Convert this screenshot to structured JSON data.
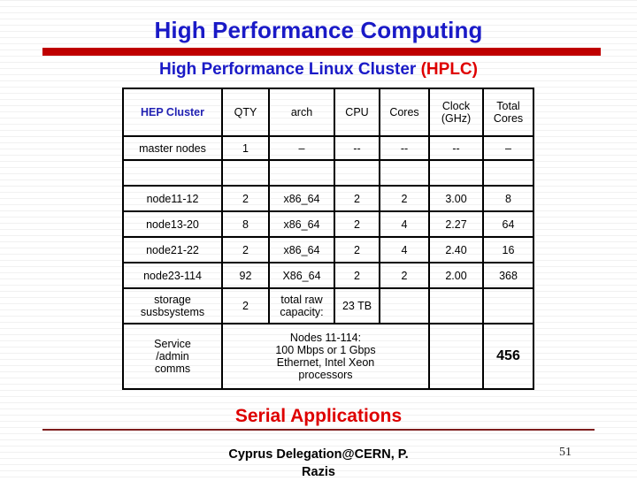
{
  "slide": {
    "title": "High Performance Computing",
    "subtitle_main": "High Performance Linux Cluster ",
    "subtitle_accent": "(HPLC)",
    "section_heading": "Serial Applications",
    "footer_line1": "Cyprus Delegation@CERN, P.",
    "footer_line2": "Razis",
    "page_number": "51",
    "accent_blue": "#1a1ac8",
    "accent_red": "#c00000",
    "rule_thin_color": "#7d1c1c"
  },
  "table": {
    "headers": {
      "cluster": "HEP Cluster",
      "qty": "QTY",
      "arch": "arch",
      "cpu": "CPU",
      "cores": "Cores",
      "clock": "Clock (GHz)",
      "clock_l1": "Clock",
      "clock_l2": "(GHz)",
      "total": "Total Cores",
      "total_l1": "Total",
      "total_l2": "Cores"
    },
    "rows": [
      {
        "cluster": "master nodes",
        "qty": "1",
        "arch": "–",
        "cpu": "--",
        "cores": "--",
        "clock": "--",
        "total": "–"
      },
      {
        "cluster": "",
        "qty": "",
        "arch": "",
        "cpu": "",
        "cores": "",
        "clock": "",
        "total": ""
      },
      {
        "cluster": "node11-12",
        "qty": "2",
        "arch": "x86_64",
        "cpu": "2",
        "cores": "2",
        "clock": "3.00",
        "total": "8"
      },
      {
        "cluster": "node13-20",
        "qty": "8",
        "arch": "x86_64",
        "cpu": "2",
        "cores": "4",
        "clock": "2.27",
        "total": "64"
      },
      {
        "cluster": "node21-22",
        "qty": "2",
        "arch": "x86_64",
        "cpu": "2",
        "cores": "4",
        "clock": "2.40",
        "total": "16"
      },
      {
        "cluster": "node23-114",
        "qty": "92",
        "arch": "X86_64",
        "cpu": "2",
        "cores": "2",
        "clock": "2.00",
        "total": "368"
      }
    ],
    "storage_row": {
      "label_l1": "storage",
      "label_l2": "susbsystems",
      "qty": "2",
      "raw_l1": "total raw",
      "raw_l2": "capacity:",
      "capacity": "23 TB"
    },
    "service_row": {
      "label_l1": "Service",
      "label_l2": "/admin",
      "label_l3": "comms",
      "note_l1": "Nodes 11-114:",
      "note_l2": "100 Mbps or 1 Gbps",
      "note_l3": "Ethernet, Intel Xeon",
      "note_l4": "processors",
      "total_cores": "456"
    }
  }
}
